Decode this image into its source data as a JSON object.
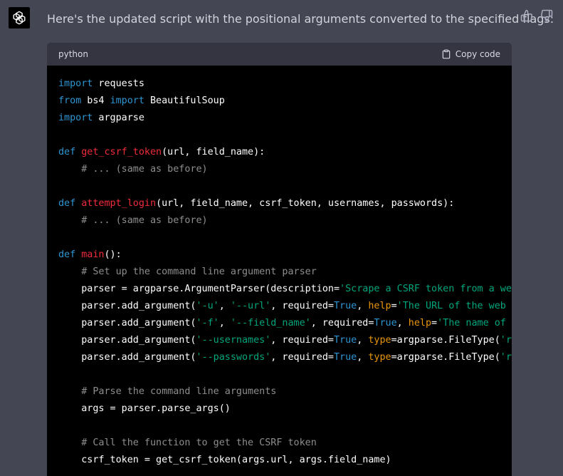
{
  "message": {
    "text": "Here's the updated script with the positional arguments converted to the specified flags:"
  },
  "feedback": {
    "thumbs_up_icon": "thumbs-up",
    "thumbs_down_icon": "thumbs-down"
  },
  "code_block": {
    "language": "python",
    "copy_label": "Copy code",
    "lines": [
      [
        {
          "t": "import",
          "c": "kw"
        },
        {
          "t": " requests",
          "c": "plain"
        }
      ],
      [
        {
          "t": "from",
          "c": "kw"
        },
        {
          "t": " bs4 ",
          "c": "plain"
        },
        {
          "t": "import",
          "c": "kw"
        },
        {
          "t": " BeautifulSoup",
          "c": "plain"
        }
      ],
      [
        {
          "t": "import",
          "c": "kw"
        },
        {
          "t": " argparse",
          "c": "plain"
        }
      ],
      [],
      [
        {
          "t": "def",
          "c": "kw"
        },
        {
          "t": " ",
          "c": "plain"
        },
        {
          "t": "get_csrf_token",
          "c": "fn"
        },
        {
          "t": "(url, field_name):",
          "c": "plain"
        }
      ],
      [
        {
          "t": "    # ... (same as before)",
          "c": "cm"
        }
      ],
      [],
      [
        {
          "t": "def",
          "c": "kw"
        },
        {
          "t": " ",
          "c": "plain"
        },
        {
          "t": "attempt_login",
          "c": "fn"
        },
        {
          "t": "(url, field_name, csrf_token, usernames, passwords):",
          "c": "plain"
        }
      ],
      [
        {
          "t": "    # ... (same as before)",
          "c": "cm"
        }
      ],
      [],
      [
        {
          "t": "def",
          "c": "kw"
        },
        {
          "t": " ",
          "c": "plain"
        },
        {
          "t": "main",
          "c": "fn"
        },
        {
          "t": "():",
          "c": "plain"
        }
      ],
      [
        {
          "t": "    # Set up the command line argument parser",
          "c": "cm"
        }
      ],
      [
        {
          "t": "    parser = argparse.ArgumentParser(description=",
          "c": "plain"
        },
        {
          "t": "'Scrape a CSRF token from a web page",
          "c": "str"
        }
      ],
      [
        {
          "t": "    parser.add_argument(",
          "c": "plain"
        },
        {
          "t": "'-u'",
          "c": "str"
        },
        {
          "t": ", ",
          "c": "plain"
        },
        {
          "t": "'--url'",
          "c": "str"
        },
        {
          "t": ", required=",
          "c": "plain"
        },
        {
          "t": "True",
          "c": "bool"
        },
        {
          "t": ", ",
          "c": "plain"
        },
        {
          "t": "help",
          "c": "tp"
        },
        {
          "t": "=",
          "c": "plain"
        },
        {
          "t": "'The URL of the web page",
          "c": "str"
        }
      ],
      [
        {
          "t": "    parser.add_argument(",
          "c": "plain"
        },
        {
          "t": "'-f'",
          "c": "str"
        },
        {
          "t": ", ",
          "c": "plain"
        },
        {
          "t": "'--field_name'",
          "c": "str"
        },
        {
          "t": ", required=",
          "c": "plain"
        },
        {
          "t": "True",
          "c": "bool"
        },
        {
          "t": ", ",
          "c": "plain"
        },
        {
          "t": "help",
          "c": "tp"
        },
        {
          "t": "=",
          "c": "plain"
        },
        {
          "t": "'The name of the",
          "c": "str"
        }
      ],
      [
        {
          "t": "    parser.add_argument(",
          "c": "plain"
        },
        {
          "t": "'--usernames'",
          "c": "str"
        },
        {
          "t": ", required=",
          "c": "plain"
        },
        {
          "t": "True",
          "c": "bool"
        },
        {
          "t": ", ",
          "c": "plain"
        },
        {
          "t": "type",
          "c": "tp"
        },
        {
          "t": "=argparse.FileType(",
          "c": "plain"
        },
        {
          "t": "'r'",
          "c": "str"
        },
        {
          "t": "),",
          "c": "plain"
        }
      ],
      [
        {
          "t": "    parser.add_argument(",
          "c": "plain"
        },
        {
          "t": "'--passwords'",
          "c": "str"
        },
        {
          "t": ", required=",
          "c": "plain"
        },
        {
          "t": "True",
          "c": "bool"
        },
        {
          "t": ", ",
          "c": "plain"
        },
        {
          "t": "type",
          "c": "tp"
        },
        {
          "t": "=argparse.FileType(",
          "c": "plain"
        },
        {
          "t": "'r'",
          "c": "str"
        },
        {
          "t": "),",
          "c": "plain"
        }
      ],
      [],
      [
        {
          "t": "    # Parse the command line arguments",
          "c": "cm"
        }
      ],
      [
        {
          "t": "    args = parser.parse_args()",
          "c": "plain"
        }
      ],
      [],
      [
        {
          "t": "    # Call the function to get the CSRF token",
          "c": "cm"
        }
      ],
      [
        {
          "t": "    csrf_token = get_csrf_token(args.url, args.field_name)",
          "c": "plain"
        }
      ]
    ]
  },
  "colors": {
    "background": "#444654",
    "code_bg": "#000000",
    "header_bg": "#343541",
    "keyword": "#2e95d3",
    "function": "#f22c3d",
    "string": "#00a67d",
    "comment": "#8e8e8e",
    "kwarg": "#e9950c"
  }
}
